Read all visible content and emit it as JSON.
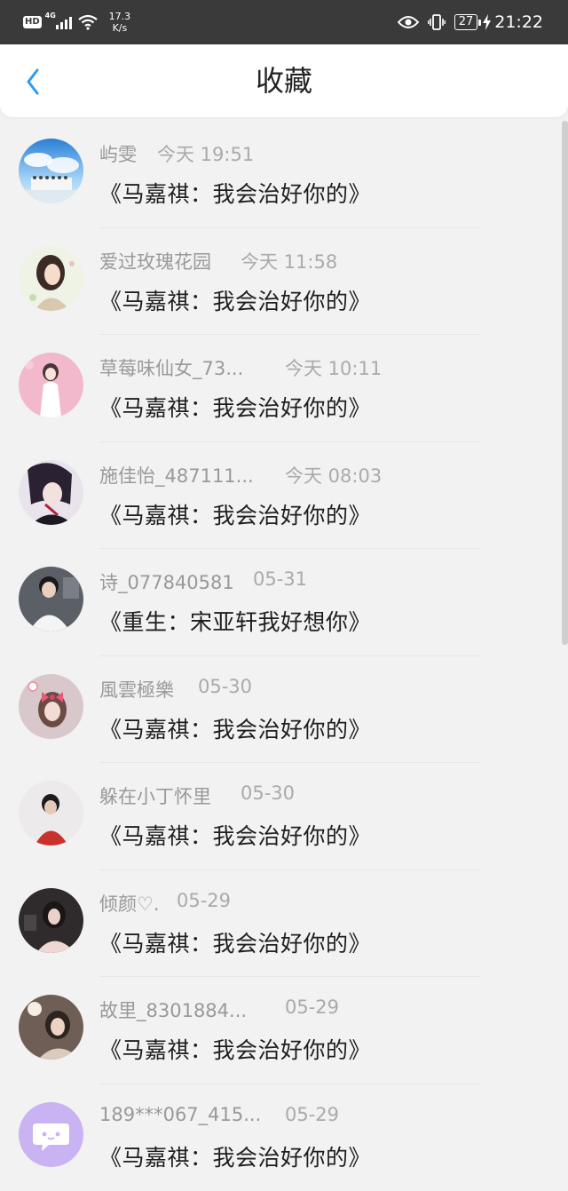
{
  "status_bar": {
    "hd": "HD",
    "network": "4G",
    "speed_value": "17.3",
    "speed_unit": "K/s",
    "battery": "27",
    "time": "21:22"
  },
  "header": {
    "title": "收藏"
  },
  "favorites": [
    {
      "name": "屿雯",
      "time": "今天 19:51",
      "story": "《马嘉祺：我会治好你的》",
      "avatar": "avatar-sky-group"
    },
    {
      "name": "爱过玫瑰花园",
      "time": "今天 11:58",
      "story": "《马嘉祺：我会治好你的》",
      "avatar": "avatar-anime-girl"
    },
    {
      "name": "草莓味仙女_73...",
      "time": "今天 10:11",
      "story": "《马嘉祺：我会治好你的》",
      "avatar": "avatar-pink-girl"
    },
    {
      "name": "施佳怡_487111...",
      "time": "今天 08:03",
      "story": "《马嘉祺：我会治好你的》",
      "avatar": "avatar-anime-dark"
    },
    {
      "name": "诗_077840581",
      "time": "05-31",
      "story": "《重生：宋亚轩我好想你》",
      "avatar": "avatar-boy-white"
    },
    {
      "name": "風雲極樂",
      "time": "05-30",
      "story": "《马嘉祺：我会治好你的》",
      "avatar": "avatar-bow-girl"
    },
    {
      "name": "躲在小丁怀里",
      "time": "05-30",
      "story": "《马嘉祺：我会治好你的》",
      "avatar": "avatar-boy-red"
    },
    {
      "name": "倾颜♡.",
      "time": "05-29",
      "story": "《马嘉祺：我会治好你的》",
      "avatar": "avatar-girl-dark"
    },
    {
      "name": "故里_8301884...",
      "time": "05-29",
      "story": "《马嘉祺：我会治好你的》",
      "avatar": "avatar-girl-lamp"
    },
    {
      "name": "189***067_415...",
      "time": "05-29",
      "story": "《马嘉祺：我会治好你的》",
      "avatar": "avatar-default-chat"
    }
  ],
  "colors": {
    "accent": "#2f9bf0",
    "status_bar": "#3a3a3a",
    "background": "#f2f2f2"
  }
}
